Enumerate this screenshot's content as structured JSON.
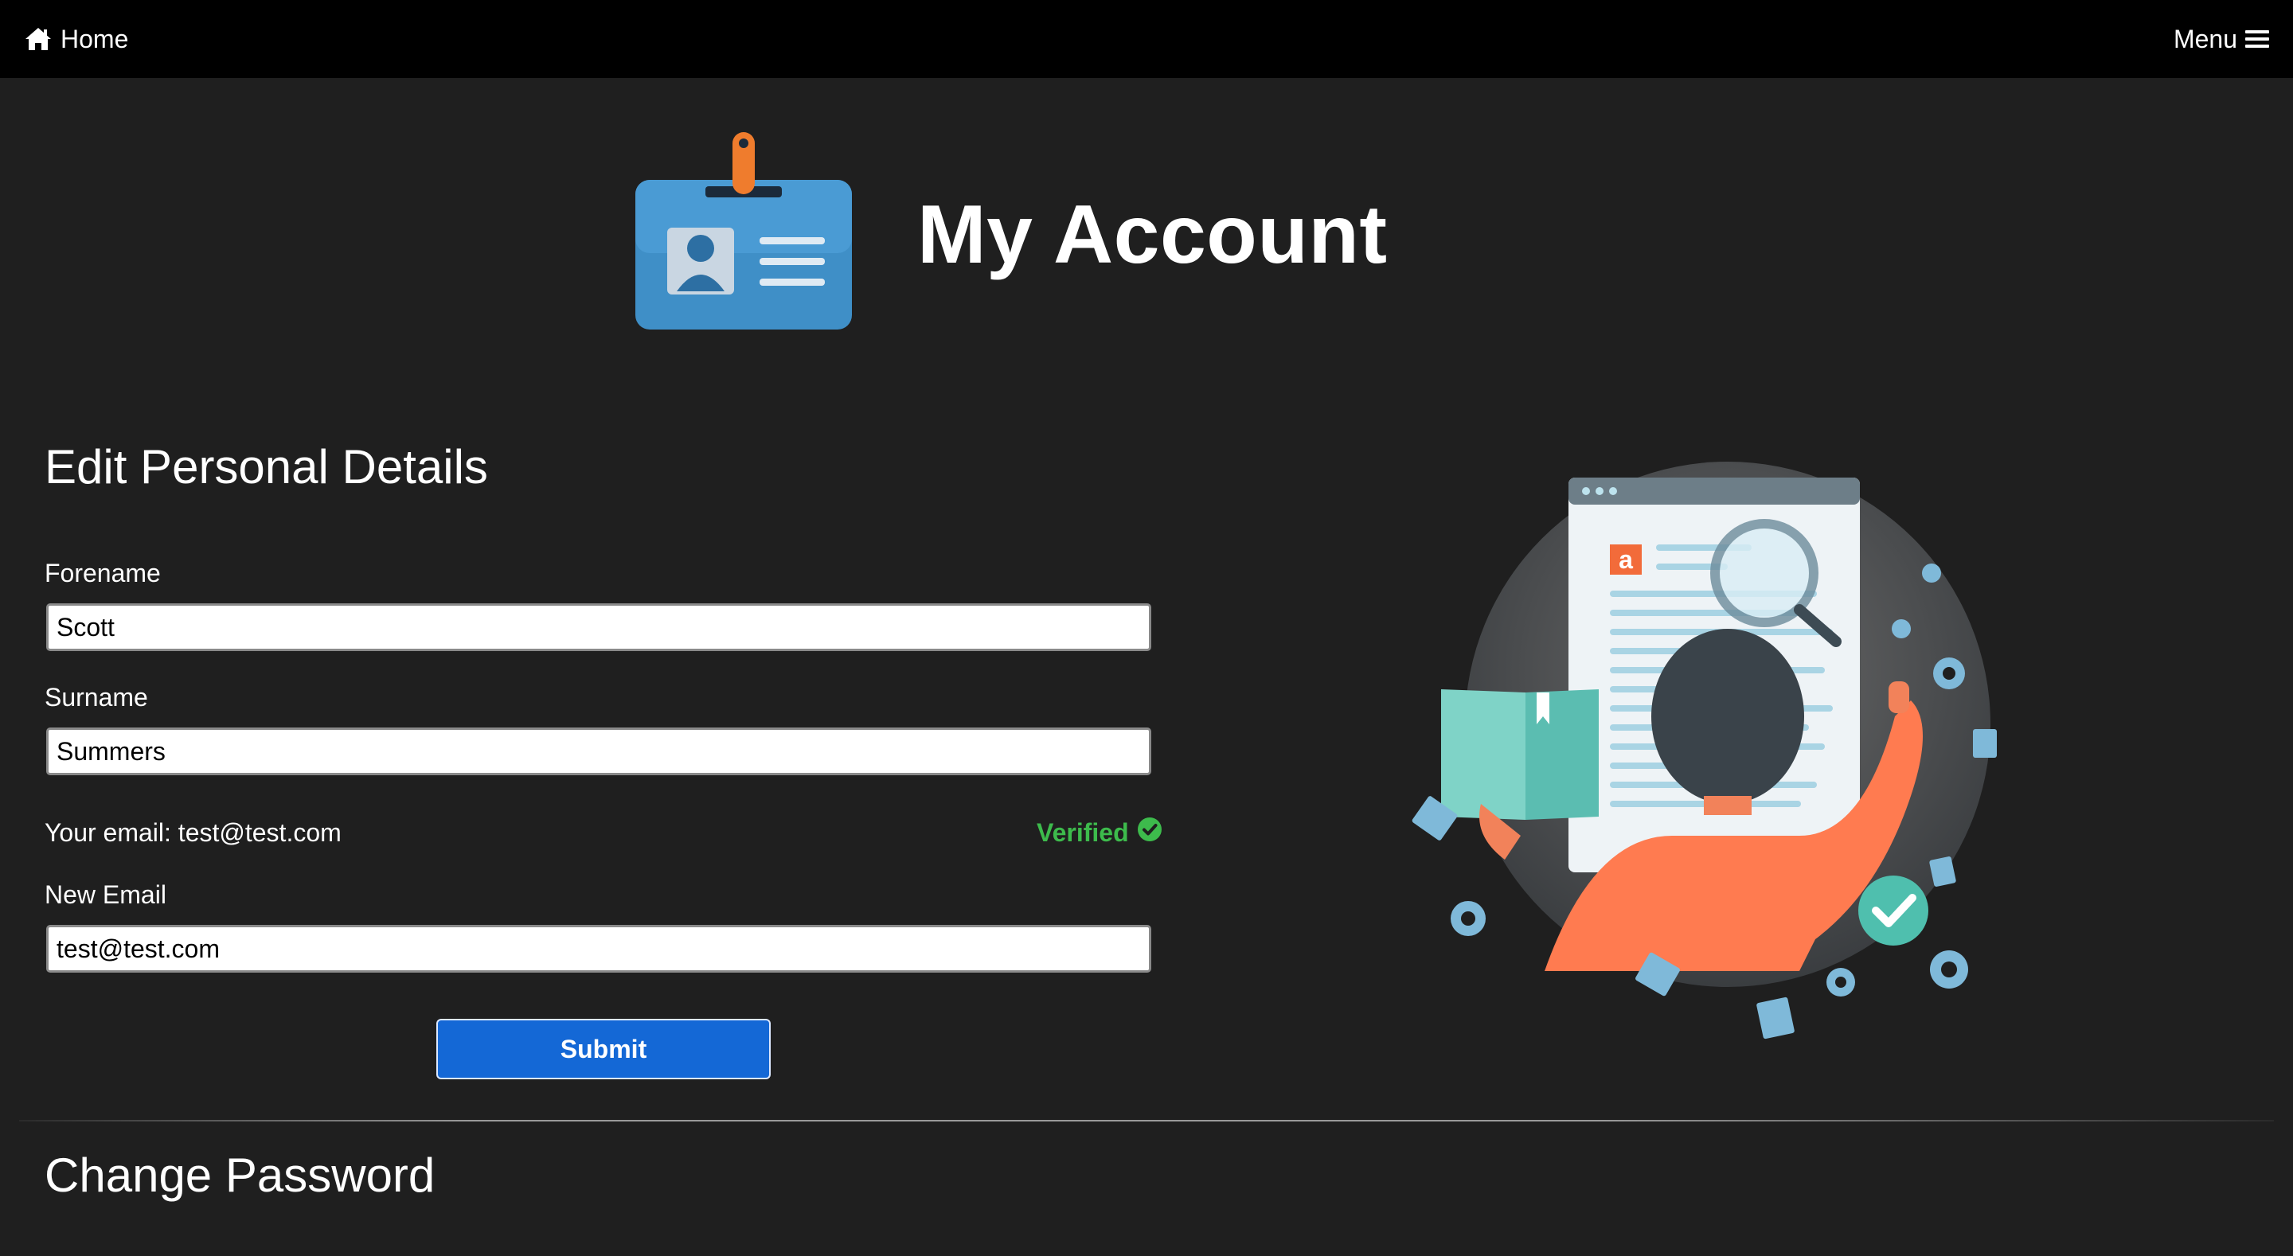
{
  "nav": {
    "home_label": "Home",
    "menu_label": "Menu"
  },
  "hero": {
    "title": "My Account"
  },
  "personal_details": {
    "heading": "Edit Personal Details",
    "forename_label": "Forename",
    "forename_value": "Scott",
    "surname_label": "Surname",
    "surname_value": "Summers",
    "email_text": "Your email: test@test.com",
    "verified_label": "Verified",
    "new_email_label": "New Email",
    "new_email_value": "test@test.com",
    "submit_label": "Submit"
  },
  "password": {
    "heading": "Change Password"
  },
  "colors": {
    "accent": "#1468d6",
    "verified": "#3dbb4c",
    "background": "#1f1f1f",
    "topbar": "#000000"
  },
  "icons": {
    "home": "home-icon",
    "menu": "hamburger-icon",
    "badge": "id-badge-icon",
    "verified": "check-circle-icon"
  }
}
